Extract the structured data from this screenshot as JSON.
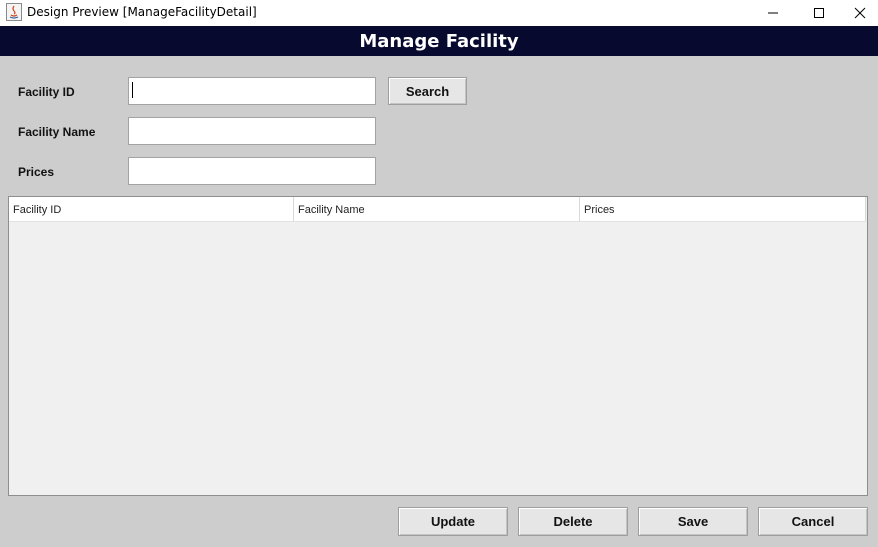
{
  "window": {
    "title": "Design Preview [ManageFacilityDetail]"
  },
  "header": {
    "title": "Manage Facility"
  },
  "form": {
    "facility_id_label": "Facility ID",
    "facility_name_label": "Facility Name",
    "prices_label": "Prices",
    "facility_id_value": "",
    "facility_name_value": "",
    "prices_value": "",
    "search_label": "Search"
  },
  "table": {
    "columns": [
      "Facility ID",
      "Facility Name",
      "Prices"
    ],
    "rows": []
  },
  "actions": {
    "update_label": "Update",
    "delete_label": "Delete",
    "save_label": "Save",
    "cancel_label": "Cancel"
  },
  "colors": {
    "header_bg": "#070a2e",
    "window_bg": "#cdcdcd",
    "table_bg": "#f0f0f0"
  }
}
